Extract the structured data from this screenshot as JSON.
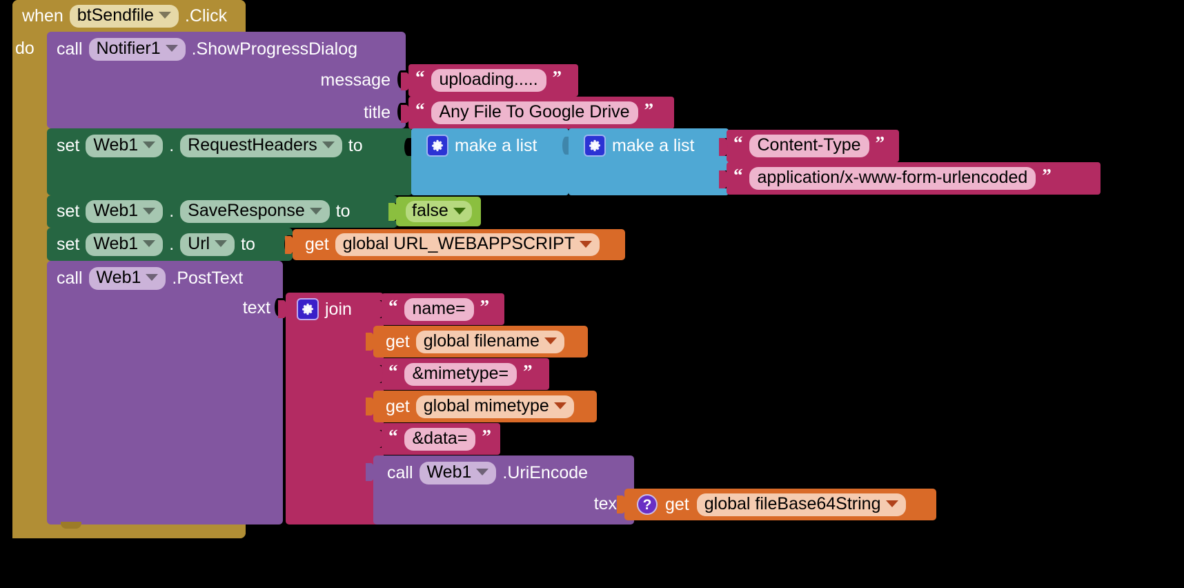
{
  "editor": {
    "name": "MIT App Inventor Blocks Editor",
    "background": "#000000"
  },
  "colors": {
    "event": "#b18e35",
    "control_purple": "#8256a0",
    "setter_green": "#266642",
    "list_blue": "#4fa8d4",
    "text_magenta": "#b32b62",
    "logic_green": "#8bbf3f",
    "variable_orange": "#d96a28",
    "mutator_gear_blue": "#2b33d4",
    "mutator_gear_indigo": "#3a1fc9"
  },
  "event_block": {
    "keyword_when": "when",
    "component": "btSendfile",
    "event": ".Click",
    "keyword_do": "do"
  },
  "notifier_call": {
    "keyword_call": "call",
    "component": "Notifier1",
    "method": ".ShowProgressDialog",
    "args": [
      {
        "name": "message",
        "value": "uploading....."
      },
      {
        "name": "title",
        "value": "Any File To Google Drive"
      }
    ]
  },
  "set_request_headers": {
    "keyword_set": "set",
    "component": "Web1",
    "dot": ".",
    "property": "RequestHeaders",
    "keyword_to": "to",
    "outer_list_label": "make a list",
    "inner_list_label": "make a list",
    "inner_items": [
      "Content-Type",
      "application/x-www-form-urlencoded"
    ]
  },
  "set_save_response": {
    "keyword_set": "set",
    "component": "Web1",
    "dot": ".",
    "property": "SaveResponse",
    "keyword_to": "to",
    "value": "false"
  },
  "set_url": {
    "keyword_set": "set",
    "component": "Web1",
    "dot": ".",
    "property": "Url",
    "keyword_to": "to",
    "getter_keyword": "get",
    "getter_variable": "global URL_WEBAPPSCRIPT"
  },
  "post_text_call": {
    "keyword_call": "call",
    "component": "Web1",
    "method": ".PostText",
    "arg_label": "text",
    "join_label": "join",
    "join_items": [
      {
        "kind": "text",
        "value": "name="
      },
      {
        "kind": "getter",
        "keyword": "get",
        "variable": "global filename"
      },
      {
        "kind": "text",
        "value": "&mimetype="
      },
      {
        "kind": "getter",
        "keyword": "get",
        "variable": "global mimetype"
      },
      {
        "kind": "text",
        "value": "&data="
      },
      {
        "kind": "call",
        "keyword_call": "call",
        "component": "Web1",
        "method": ".UriEncode",
        "arg_label": "text",
        "inner_badge": "?",
        "inner_getter_keyword": "get",
        "inner_getter_variable": "global fileBase64String"
      }
    ]
  },
  "icons": {
    "mutator": "gear-icon",
    "dropdown": "chevron-down-icon",
    "warning": "question-mark-icon"
  }
}
